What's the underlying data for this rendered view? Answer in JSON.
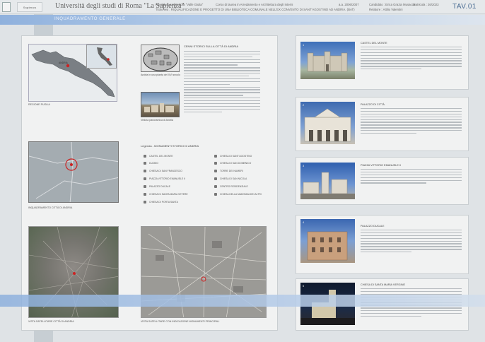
{
  "header": {
    "university": "Università degli studi di Roma \"La Sapienza\"",
    "faculty": "Facoltà di Architettura \"Valle Giulia\"",
    "course": "Corso di laurea in Arredamento e Architettura degli Interni",
    "year": "a.a. 2006/2007",
    "candidate": "Candidato : Erica Grazia Musacco",
    "matricola": "Matricola : 26/2023",
    "thesis": "Titolo tesi : RIQUALIFICAZIONE E PROGETTO DI UNA BIBLIOTECA COMUNALE NELL'EX CONVENTO DI SANT'AGOSTINO AD ANDRIA. (BAT)",
    "relatore": "Relatore : Attilio Valentini",
    "tav": "TAV.01"
  },
  "section_title": "INQUADRAMENTO GENERALE",
  "left": {
    "map_caption": "REGIONE PUGLIA",
    "andria_label": "ANDRIA",
    "ring_title": "CENNI STORICI SULLA CITTÀ DI ANDRIA",
    "old_map_caption": "Andria in una pianta del XVI secolo",
    "city_photo_caption": "Veduta panoramica di Andria",
    "location_caption": "INQUADRAMENTO CITTÀ DI ANDRIA",
    "legend_title": "Legenda - MONUMENTI STORICI DI ANDRIA",
    "legend": [
      "CASTEL DEL MONTE",
      "DUOMO",
      "CHIESA DI SAN FRANCESCO",
      "PIAZZA VITTORIO EMANUELE II",
      "PALAZZO DUCALE",
      "CHIESA DI SANTA MARIA VETERE",
      "CHIESA DI PORTA SANTA",
      "CHIESA DI SANT'AGOSTINO",
      "CHIESA DI SAN DOMENICO",
      "TORRE DEI NUMERI",
      "CHIESA DI SAN NICOLA",
      "CENTRO RESIDENZIALE",
      "CHIESA DELLA MADONNA DEI ALTRI"
    ],
    "sat1_caption": "VISTA SATELLITARE CITTÀ DI ANDRIA",
    "sat2_caption": "VISTA SATELLITARE CON INDICAZIONE MONUMENTI PRINCIPALI"
  },
  "right": [
    {
      "num": "1",
      "title": "CASTEL DEL MONTE"
    },
    {
      "num": "2",
      "title": "PALAZZO DI CITTÀ"
    },
    {
      "num": "3",
      "title": "PIAZZA VITTORIO EMANUELE II"
    },
    {
      "num": "4",
      "title": "PALAZZO DUCALE"
    },
    {
      "num": "5",
      "title": "CHIESA DI SANTA MARIA VERGINE"
    }
  ]
}
